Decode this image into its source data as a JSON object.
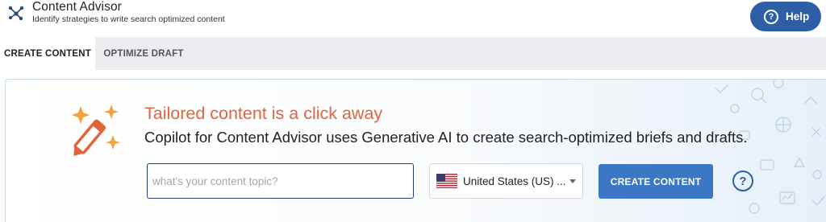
{
  "header": {
    "title": "Content Advisor",
    "subtitle": "Identify strategies to write search optimized content",
    "app_icon": "graph-nodes-icon",
    "help_label": "Help",
    "help_icon": "question-circle-icon"
  },
  "tabs": [
    {
      "label": "CREATE CONTENT",
      "active": true
    },
    {
      "label": "OPTIMIZE DRAFT",
      "active": false
    }
  ],
  "card": {
    "icon": "magic-wand-sparkles-icon",
    "headline": "Tailored content is a click away",
    "description": "Copilot for Content Advisor uses Generative AI to create search-optimized briefs and drafts.",
    "topic_input": {
      "value": "",
      "placeholder": "what's your content topic?"
    },
    "country_select": {
      "value": "United States (US) ...",
      "flag_icon": "us-flag-icon"
    },
    "create_button_label": "CREATE CONTENT",
    "help_icon": "question-circle-icon"
  },
  "colors": {
    "accent_blue": "#2e5ea6",
    "button_blue": "#3b77c4",
    "headline_orange": "#e0653a"
  }
}
